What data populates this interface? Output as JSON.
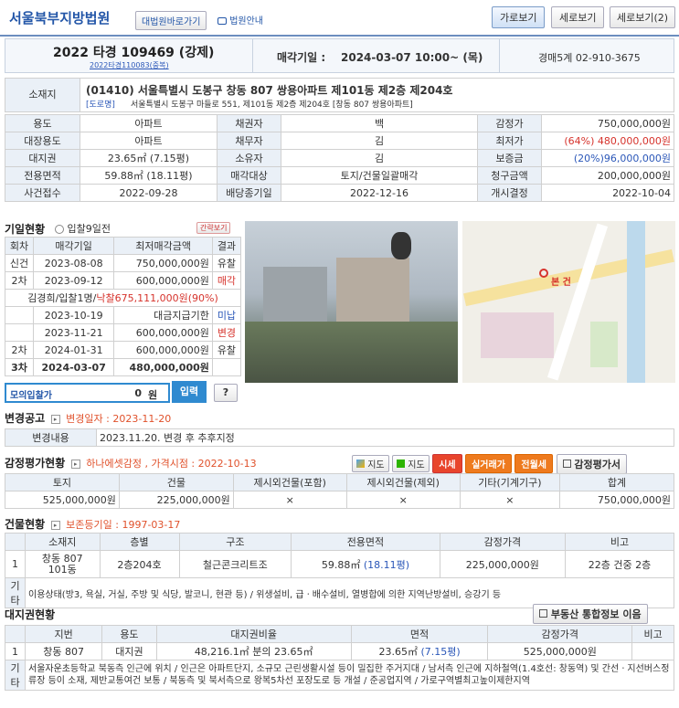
{
  "header": {
    "court": "서울북부지방법원",
    "btn_shortcut": "대법원바로가기",
    "btn_guide": "법원안내",
    "view_horizontal": "가로보기",
    "view_vertical": "세로보기",
    "view_vertical2": "세로보기(2)"
  },
  "case": {
    "number": "2022 타경 109469 (강제)",
    "dup": "2022타경110083(중복)",
    "sale_label": "매각기일 :",
    "sale_date": "2024-03-07 10:00~ (목)",
    "dept": "경매5계 02-910-3675"
  },
  "location": {
    "label": "소재지",
    "addr": "(01410) 서울특별시 도봉구 창동 807 쌍용아파트 제101동 제2층 제204호",
    "road_tag": "[도로명]",
    "road": "서울특별시 도봉구 마들로 551, 제101동 제2층 제204호 [창동 807 쌍용아파트]"
  },
  "info_rows": [
    [
      "용도",
      "아파트",
      "채권자",
      "백",
      "감정가",
      "750,000,000원"
    ],
    [
      "대장용도",
      "아파트",
      "채무자",
      "김",
      "최저가",
      "(64%) 480,000,000원"
    ],
    [
      "대지권",
      "23.65㎡ (7.15평)",
      "소유자",
      "김",
      "보증금",
      "(20%)96,000,000원"
    ],
    [
      "전용면적",
      "59.88㎡ (18.11평)",
      "매각대상",
      "토지/건물일괄매각",
      "청구금액",
      "200,000,000원"
    ],
    [
      "사건접수",
      "2022-09-28",
      "배당종기일",
      "2022-12-16",
      "개시결정",
      "2022-10-04"
    ]
  ],
  "history": {
    "title": "기일현황",
    "badge": "입찰9일전",
    "toggle": "간략보기",
    "headers": [
      "회차",
      "매각기일",
      "최저매각금액",
      "결과"
    ],
    "rows": [
      [
        "신건",
        "2023-08-08",
        "750,000,000원",
        "유찰"
      ],
      [
        "2차",
        "2023-09-12",
        "600,000,000원",
        "매각"
      ],
      [
        "",
        "2023-10-19",
        "대금지급기한",
        "미납"
      ],
      [
        "",
        "2023-11-21",
        "600,000,000원",
        "변경"
      ],
      [
        "2차",
        "2024-01-31",
        "600,000,000원",
        "유찰"
      ],
      [
        "3차",
        "2024-03-07",
        "480,000,000원",
        ""
      ]
    ],
    "winner_a": "김경희/입찰1명/",
    "winner_b": "낙찰675,111,000원(90%)"
  },
  "mock_bid": {
    "label": "모의입찰가",
    "value": "0",
    "unit": "원",
    "submit": "입력",
    "help": "?"
  },
  "map": {
    "marker": "본 건"
  },
  "change": {
    "title": "변경공고",
    "date_label": "변경일자 : 2023-11-20",
    "row_label": "변경내용",
    "row_text": "2023.11.20. 변경 후 추후지정"
  },
  "appraisal": {
    "title": "감정평가현황",
    "sub": "하나에셋감정 , 가격시점 : 2022-10-13",
    "btns": [
      "지도",
      "지도",
      "시세",
      "실거래가",
      "전월세",
      "감정평가서"
    ],
    "headers": [
      "토지",
      "건물",
      "제시외건물(포함)",
      "제시외건물(제외)",
      "기타(기계기구)",
      "합계"
    ],
    "row": [
      "525,000,000원",
      "225,000,000원",
      "×",
      "×",
      "×",
      "750,000,000원"
    ]
  },
  "building": {
    "title": "건물현황",
    "sub": "보존등기일 : 1997-03-17",
    "headers": [
      "",
      "소재지",
      "층별",
      "구조",
      "전용면적",
      "감정가격",
      "비고"
    ],
    "row": [
      "1",
      "창동 807\n101동",
      "2층204호",
      "철근콘크리트조",
      "59.88㎡",
      "(18.11평)",
      "225,000,000원",
      "22층 건중 2층"
    ],
    "etc_label": "기타",
    "etc": "이용상태(방3, 욕실, 거실, 주방 및 식당, 발코니, 현관 등) / 위생설비, 급ㆍ배수설비, 열병합에 의한 지역난방설비, 승강기 등"
  },
  "land": {
    "title": "대지권현황",
    "btn": "부동산 통합정보 이음",
    "headers": [
      "",
      "지번",
      "용도",
      "대지권비율",
      "면적",
      "감정가격",
      "비고"
    ],
    "row": [
      "1",
      "창동 807",
      "대지권",
      "48,216.1㎡ 분의 23.65㎡",
      "23.65㎡",
      "(7.15평)",
      "525,000,000원",
      ""
    ],
    "etc_label": "기타",
    "etc": "서울자운초등학교 북동측 인근에 위치 / 인근은 아파트단지, 소규모 근린생활시설 등이 밀집한 주거지대 / 남서측 인근에 지하철역(1.4호선: 창동역) 및 간선ㆍ지선버스정류장 등이 소재, 제반교통여건 보통 / 북동측 및 북서측으로 왕복5차선 포장도로 등 개설 / 준공업지역 / 가로구역별최고높이제한지역"
  }
}
